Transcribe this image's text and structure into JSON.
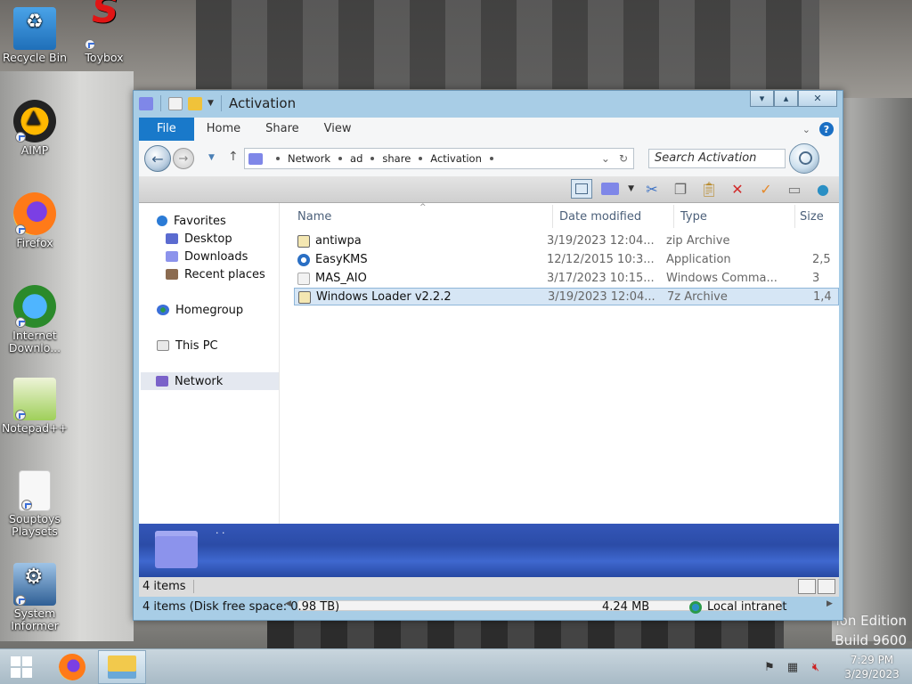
{
  "desktop": {
    "icons": [
      {
        "label": "Recycle Bin"
      },
      {
        "label": "Toybox"
      },
      {
        "label": "AIMP"
      },
      {
        "label": "Firefox"
      },
      {
        "label": "Internet Downlo..."
      },
      {
        "label": "Notepad++"
      },
      {
        "label": "Souptoys Playsets"
      },
      {
        "label": "System Informer"
      }
    ],
    "watermark_line1": "ion Edition",
    "watermark_line2": "Build 9600"
  },
  "window": {
    "title": "Activation",
    "ribbon_tabs": [
      "File",
      "Home",
      "Share",
      "View"
    ],
    "help_label": "?",
    "address": {
      "crumbs": [
        "Network",
        "ad",
        "share",
        "Activation"
      ]
    },
    "search_placeholder": "Search Activation",
    "nav": {
      "favorites": "Favorites",
      "desktop": "Desktop",
      "downloads": "Downloads",
      "recent": "Recent places",
      "homegroup": "Homegroup",
      "this_pc": "This PC",
      "network": "Network"
    },
    "columns": {
      "name": "Name",
      "date": "Date modified",
      "type": "Type",
      "size": "Size"
    },
    "files": [
      {
        "name": "antiwpa",
        "date": "3/19/2023 12:04...",
        "type": "zip Archive",
        "size": ""
      },
      {
        "name": "EasyKMS",
        "date": "12/12/2015 10:3...",
        "type": "Application",
        "size": "2,5"
      },
      {
        "name": "MAS_AIO",
        "date": "3/17/2023 10:15...",
        "type": "Windows Comma...",
        "size": "3"
      },
      {
        "name": "Windows Loader v2.2.2",
        "date": "3/19/2023 12:04...",
        "type": "7z Archive",
        "size": "1,4"
      }
    ],
    "details_text": "· ·",
    "status_items": "4 items",
    "status_bar": {
      "disk": "4 items (Disk free space: 0.98 TB)",
      "size": "4.24 MB",
      "zone": "Local intranet"
    }
  },
  "taskbar": {
    "time": "7:29 PM",
    "date": "3/29/2023"
  },
  "colors": {
    "accent": "#1979ca",
    "window_frame": "#a8cde6",
    "selection": "#d6e6f5",
    "folder": "#8c93ec"
  }
}
